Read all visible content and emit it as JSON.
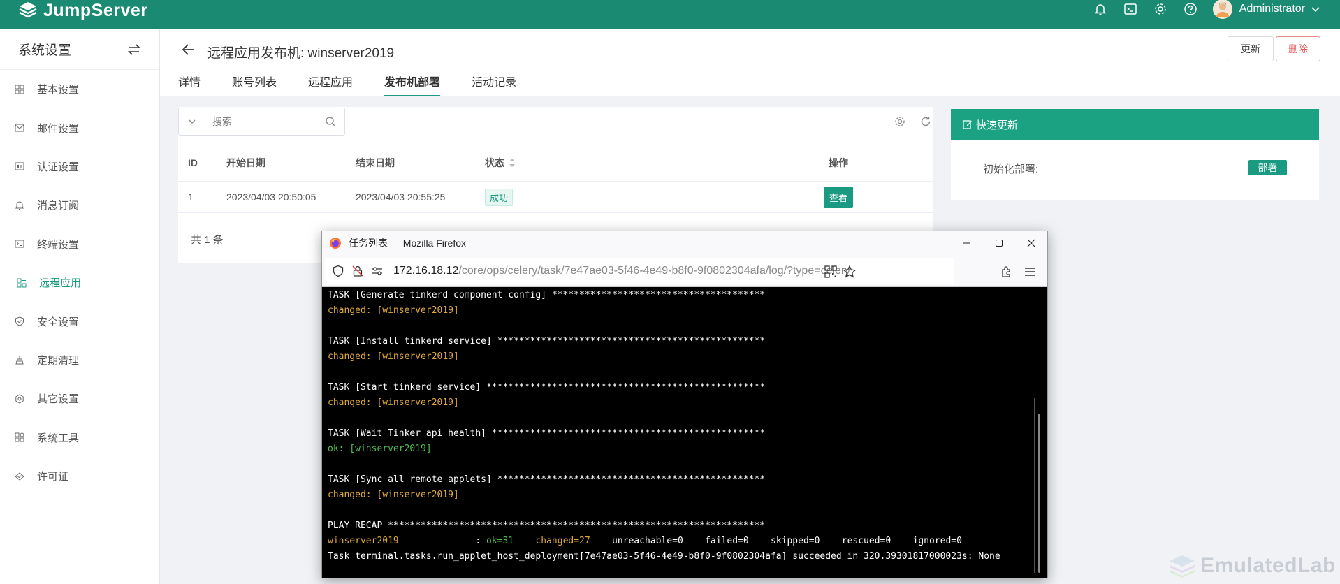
{
  "app": {
    "brand": "JumpServer",
    "colors": {
      "primary": "#1a8a73",
      "accent": "#1a9a80",
      "danger": "#e05a5a"
    }
  },
  "topbar": {
    "icons": [
      "bell-icon",
      "terminal-icon",
      "gear-icon",
      "help-icon"
    ],
    "user_name": "Administrator"
  },
  "sidebar": {
    "title": "系统设置",
    "items": [
      {
        "label": "基本设置",
        "icon": "grid-icon"
      },
      {
        "label": "邮件设置",
        "icon": "mail-icon"
      },
      {
        "label": "认证设置",
        "icon": "id-card-icon"
      },
      {
        "label": "消息订阅",
        "icon": "bell-icon"
      },
      {
        "label": "终端设置",
        "icon": "terminal-icon"
      },
      {
        "label": "远程应用",
        "icon": "apps-icon",
        "active": true
      },
      {
        "label": "安全设置",
        "icon": "shield-icon"
      },
      {
        "label": "定期清理",
        "icon": "broom-icon"
      },
      {
        "label": "其它设置",
        "icon": "gear-icon"
      },
      {
        "label": "系统工具",
        "icon": "tools-icon"
      },
      {
        "label": "许可证",
        "icon": "license-icon"
      }
    ]
  },
  "header": {
    "title": "远程应用发布机: winserver2019",
    "update_label": "更新",
    "delete_label": "删除",
    "tabs": [
      {
        "label": "详情"
      },
      {
        "label": "账号列表"
      },
      {
        "label": "远程应用"
      },
      {
        "label": "发布机部署",
        "active": true
      },
      {
        "label": "活动记录"
      }
    ]
  },
  "table": {
    "search_placeholder": "搜索",
    "columns": [
      "ID",
      "开始日期",
      "结束日期",
      "状态",
      "操作"
    ],
    "rows": [
      {
        "id": "1",
        "start": "2023/04/03 20:50:05",
        "end": "2023/04/03 20:55:25",
        "status": "成功",
        "action": "查看"
      }
    ],
    "total": "共 1 条"
  },
  "quick_update": {
    "title": "快速更新",
    "label": "初始化部署:",
    "button": "部署"
  },
  "firefox": {
    "title": "任务列表 — Mozilla Firefox",
    "url_host": "172.16.18.12",
    "url_path": "/core/ops/celery/task/7e47ae03-5f46-4e49-b8f0-9f0802304afa/log/?type=celery",
    "log": [
      {
        "text": "TASK [Generate tinkerd component config] ***************************************",
        "color": "white"
      },
      {
        "text": "changed: [winserver2019]",
        "color": "orange"
      },
      {
        "text": "",
        "color": "white"
      },
      {
        "text": "TASK [Install tinkerd service] *************************************************",
        "color": "white"
      },
      {
        "text": "changed: [winserver2019]",
        "color": "orange"
      },
      {
        "text": "",
        "color": "white"
      },
      {
        "text": "TASK [Start tinkerd service] ***************************************************",
        "color": "white"
      },
      {
        "text": "changed: [winserver2019]",
        "color": "orange"
      },
      {
        "text": "",
        "color": "white"
      },
      {
        "text": "TASK [Wait Tinker api health] **************************************************",
        "color": "white"
      },
      {
        "text": "ok: [winserver2019]",
        "color": "green"
      },
      {
        "text": "",
        "color": "white"
      },
      {
        "text": "TASK [Sync all remote applets] *************************************************",
        "color": "white"
      },
      {
        "text": "changed: [winserver2019]",
        "color": "orange"
      },
      {
        "text": "",
        "color": "white"
      },
      {
        "text": "PLAY RECAP *********************************************************************",
        "color": "white"
      }
    ],
    "recap": {
      "host": "winserver2019",
      "sep": "              : ",
      "ok": "ok=31",
      "changed": "changed=27",
      "rest": "unreachable=0    failed=0    skipped=0    rescued=0    ignored=0"
    },
    "final_line": "Task terminal.tasks.run_applet_host_deployment[7e47ae03-5f46-4e49-b8f0-9f0802304afa] succeeded in 320.39301817000023s: None"
  },
  "watermark": {
    "text": "EmulatedLab"
  }
}
